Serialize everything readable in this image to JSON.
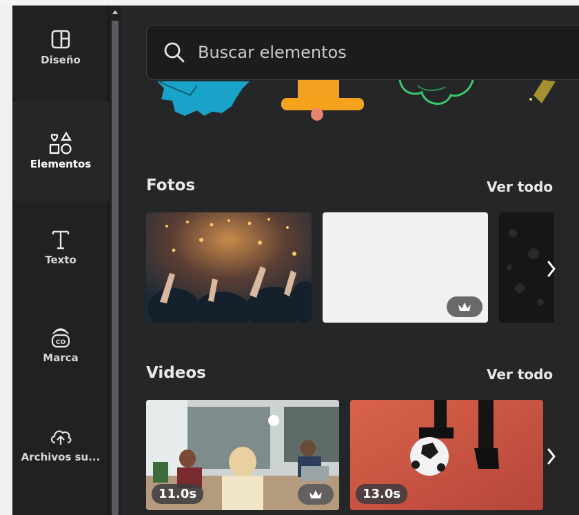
{
  "sidebar": {
    "items": [
      {
        "label": "Diseño",
        "icon": "layout-icon"
      },
      {
        "label": "Elementos",
        "icon": "shapes-icon",
        "active": true
      },
      {
        "label": "Texto",
        "icon": "text-icon"
      },
      {
        "label": "Marca",
        "icon": "brand-icon"
      },
      {
        "label": "Archivos su...",
        "icon": "cloud-upload-icon"
      }
    ]
  },
  "search": {
    "placeholder": "Buscar elementos"
  },
  "sections": {
    "photos": {
      "title": "Fotos",
      "see_all": "Ver todo",
      "items": [
        {
          "name": "concert-crowd-photo"
        },
        {
          "name": "white-texture-photo",
          "premium": true
        },
        {
          "name": "dark-texture-photo"
        }
      ]
    },
    "videos": {
      "title": "Videos",
      "see_all": "Ver todo",
      "items": [
        {
          "name": "office-video",
          "duration": "11.0s",
          "premium": true
        },
        {
          "name": "soccer-video",
          "duration": "13.0s"
        }
      ]
    }
  },
  "colors": {
    "sidebar_bg": "#18191b",
    "panel_bg": "#252628",
    "text": "#e8e8e8"
  }
}
